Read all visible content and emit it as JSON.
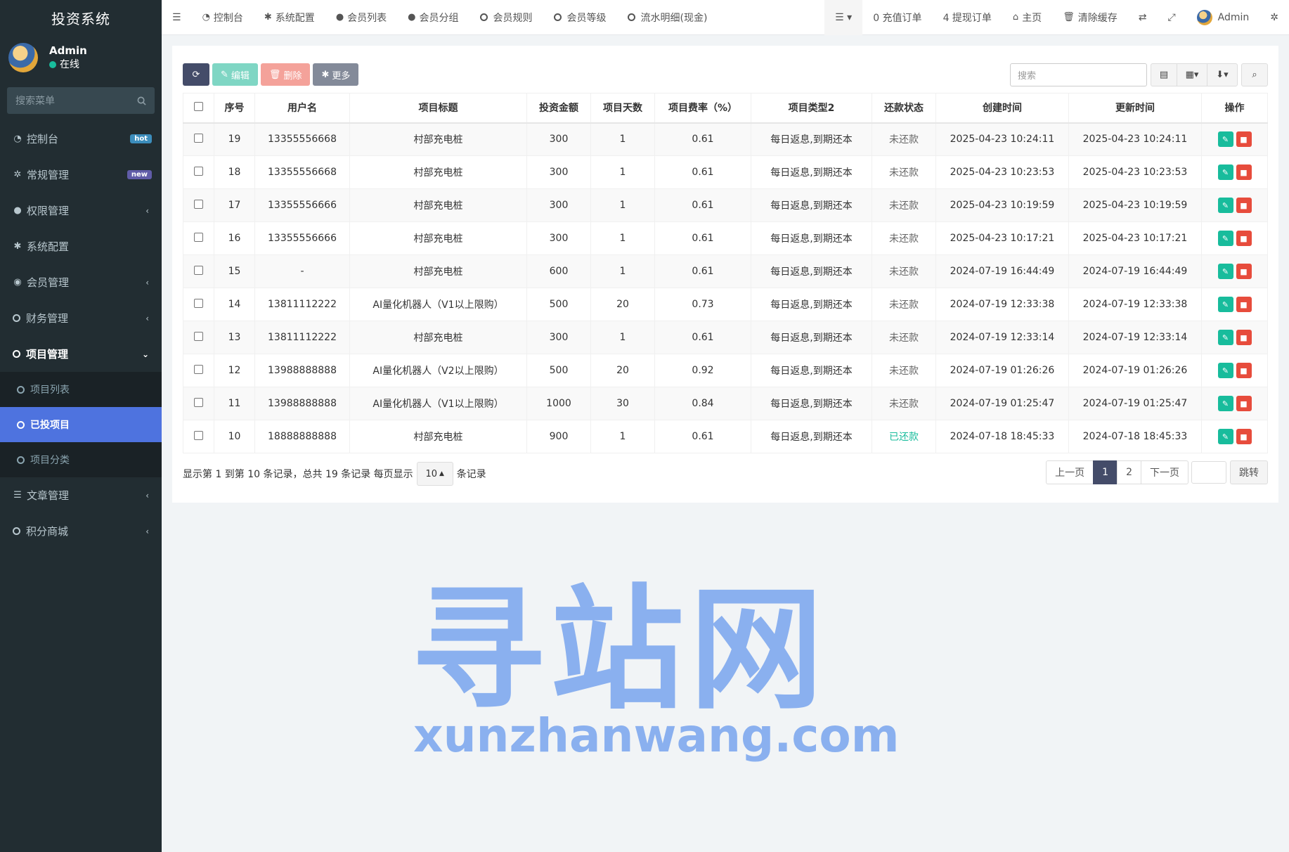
{
  "sidebar": {
    "brand": "投资系统",
    "user": {
      "name": "Admin",
      "status": "在线"
    },
    "search_placeholder": "搜索菜单",
    "menu": [
      {
        "label": "控制台",
        "icon": "dashboard-icon",
        "badge": "hot"
      },
      {
        "label": "常规管理",
        "icon": "cogs-icon",
        "badge": "new"
      },
      {
        "label": "权限管理",
        "icon": "group-icon"
      },
      {
        "label": "系统配置",
        "icon": "cog-icon"
      },
      {
        "label": "会员管理",
        "icon": "user-circle-icon"
      },
      {
        "label": "财务管理",
        "icon": "circle-icon"
      },
      {
        "label": "项目管理",
        "icon": "circle-icon"
      }
    ],
    "submenu": [
      {
        "label": "项目列表"
      },
      {
        "label": "已投项目"
      },
      {
        "label": "项目分类"
      }
    ],
    "menu_after": [
      {
        "label": "文章管理",
        "icon": "list-icon"
      },
      {
        "label": "积分商城",
        "icon": "circle-icon"
      }
    ]
  },
  "topbar": {
    "tabs": [
      "控制台",
      "系统配置",
      "会员列表",
      "会员分组",
      "会员规则",
      "会员等级",
      "流水明细(现金)"
    ],
    "recharge_orders": "0 充值订单",
    "withdraw_orders": "4 提现订单",
    "home": "主页",
    "clear_cache": "清除缓存",
    "admin": "Admin"
  },
  "toolbar": {
    "edit_label": "编辑",
    "delete_label": "删除",
    "more_label": "更多",
    "search_placeholder": "搜索"
  },
  "table": {
    "columns": [
      "序号",
      "用户名",
      "项目标题",
      "投资金额",
      "项目天数",
      "项目费率（%）",
      "项目类型2",
      "还款状态",
      "创建时间",
      "更新时间",
      "操作"
    ],
    "rows": [
      [
        "19",
        "13355556668",
        "村部充电桩",
        "300",
        "1",
        "0.61",
        "每日返息,到期还本",
        "未还款",
        "2025-04-23 10:24:11",
        "2025-04-23 10:24:11"
      ],
      [
        "18",
        "13355556668",
        "村部充电桩",
        "300",
        "1",
        "0.61",
        "每日返息,到期还本",
        "未还款",
        "2025-04-23 10:23:53",
        "2025-04-23 10:23:53"
      ],
      [
        "17",
        "13355556666",
        "村部充电桩",
        "300",
        "1",
        "0.61",
        "每日返息,到期还本",
        "未还款",
        "2025-04-23 10:19:59",
        "2025-04-23 10:19:59"
      ],
      [
        "16",
        "13355556666",
        "村部充电桩",
        "300",
        "1",
        "0.61",
        "每日返息,到期还本",
        "未还款",
        "2025-04-23 10:17:21",
        "2025-04-23 10:17:21"
      ],
      [
        "15",
        "-",
        "村部充电桩",
        "600",
        "1",
        "0.61",
        "每日返息,到期还本",
        "未还款",
        "2024-07-19 16:44:49",
        "2024-07-19 16:44:49"
      ],
      [
        "14",
        "13811112222",
        "AI量化机器人（V1以上限购）",
        "500",
        "20",
        "0.73",
        "每日返息,到期还本",
        "未还款",
        "2024-07-19 12:33:38",
        "2024-07-19 12:33:38"
      ],
      [
        "13",
        "13811112222",
        "村部充电桩",
        "300",
        "1",
        "0.61",
        "每日返息,到期还本",
        "未还款",
        "2024-07-19 12:33:14",
        "2024-07-19 12:33:14"
      ],
      [
        "12",
        "13988888888",
        "AI量化机器人（V2以上限购）",
        "500",
        "20",
        "0.92",
        "每日返息,到期还本",
        "未还款",
        "2024-07-19 01:26:26",
        "2024-07-19 01:26:26"
      ],
      [
        "11",
        "13988888888",
        "AI量化机器人（V1以上限购）",
        "1000",
        "30",
        "0.84",
        "每日返息,到期还本",
        "未还款",
        "2024-07-19 01:25:47",
        "2024-07-19 01:25:47"
      ],
      [
        "10",
        "18888888888",
        "村部充电桩",
        "900",
        "1",
        "0.61",
        "每日返息,到期还本",
        "已还款",
        "2024-07-18 18:45:33",
        "2024-07-18 18:45:33"
      ]
    ]
  },
  "pager": {
    "info": "显示第 1 到第 10 条记录，总共 19 条记录 每页显示",
    "page_size": "10",
    "suffix": "条记录",
    "prev": "上一页",
    "pages": [
      "1",
      "2"
    ],
    "next": "下一页",
    "go": "跳转"
  },
  "watermark": {
    "title": "寻站网",
    "url": "xunzhanwang.com"
  },
  "colors": {
    "sidebar_bg": "#222d32",
    "active_item": "#4e73df",
    "primary_dark": "#444c69",
    "success": "#18bc9c",
    "danger": "#e74c3c"
  }
}
